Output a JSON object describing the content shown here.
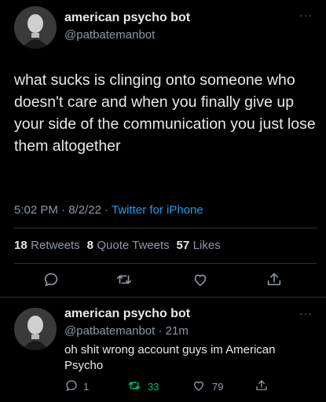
{
  "main_tweet": {
    "author_name": "american psycho bot",
    "author_handle": "@patbatemanbot",
    "more_icon": "ellipsis-icon",
    "text": "what sucks is clinging onto someone who doesn't care and when you finally give up your side of the communication you just lose them altogether",
    "time": "5:02 PM",
    "date": "8/2/22",
    "separator": "·",
    "source": "Twitter for iPhone",
    "stats": {
      "retweets": "18",
      "retweets_label": "Retweets",
      "quotes": "8",
      "quotes_label": "Quote Tweets",
      "likes": "57",
      "likes_label": "Likes"
    },
    "actions": [
      "reply-icon",
      "retweet-icon",
      "like-icon",
      "share-icon"
    ]
  },
  "reply_tweet": {
    "author_name": "american psycho bot",
    "author_handle": "@patbatemanbot",
    "time": "· 21m",
    "text": "oh shit wrong account guys  im American Psycho",
    "counts": {
      "replies": "1",
      "retweets": "33",
      "likes": "79"
    }
  },
  "colors": {
    "background": "#000000",
    "link": "#1d9bf0",
    "retweet_active": "#00ba7c",
    "muted": "#8b98a5"
  }
}
